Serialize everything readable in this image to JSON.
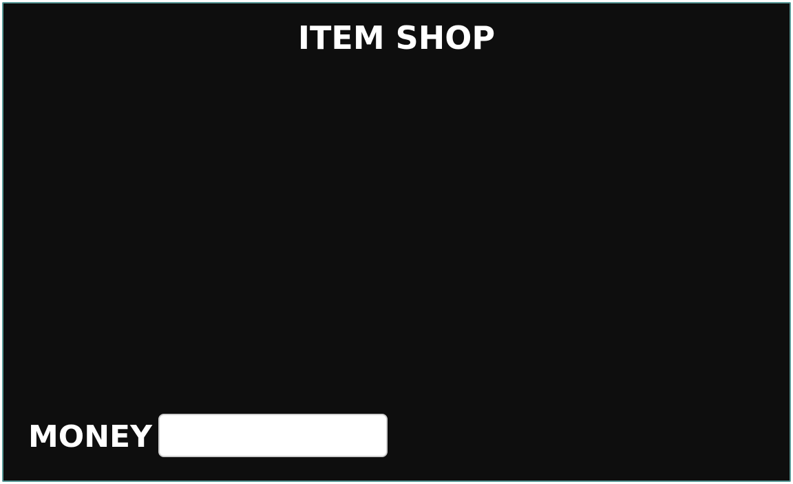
{
  "shop": {
    "title": "ITEM SHOP",
    "items": []
  },
  "money": {
    "label": "MONEY",
    "value": ""
  },
  "colors": {
    "panel_background": "#0e0e0e",
    "panel_border": "#5a9a98",
    "text": "#ffffff",
    "money_field_background": "#ffffff",
    "money_field_border": "#cfcfcf"
  }
}
